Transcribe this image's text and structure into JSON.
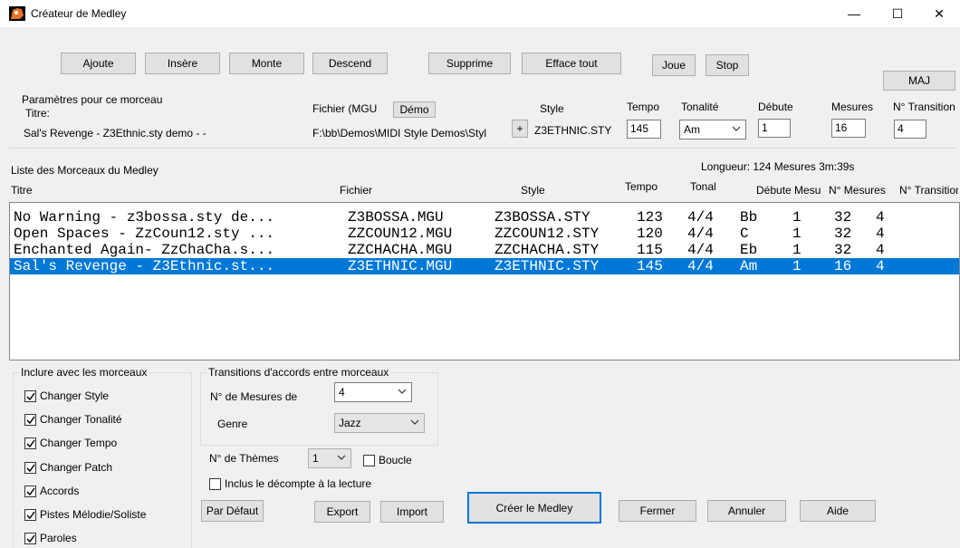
{
  "window": {
    "title": "Créateur de Medley",
    "controls": {
      "minimize": "—",
      "maximize": "☐",
      "close": "✕"
    }
  },
  "toolbar": {
    "add": "Ajoute",
    "insert": "Insère",
    "up": "Monte",
    "down": "Descend",
    "delete": "Supprime",
    "clear_all": "Efface tout",
    "play": "Joue",
    "stop": "Stop",
    "update": "MAJ"
  },
  "params": {
    "group_label": "Paramètres pour ce morceau",
    "title_label": "Titre:",
    "title_value": "Sal's Revenge - Z3Ethnic.sty demo - -",
    "file_label": "Fichier (MGU",
    "demo_button": "Démo",
    "file_value": "F:\\bb\\Demos\\MIDI Style Demos\\Styl",
    "style_label": "Style",
    "style_plus": "+",
    "style_value": "Z3ETHNIC.STY",
    "tempo_label": "Tempo",
    "tempo_value": "145",
    "key_label": "Tonalité",
    "key_value": "Am",
    "start_label": "Débute",
    "start_value": "1",
    "measures_label": "Mesures",
    "measures_value": "16",
    "transition_label": "N° Transition",
    "transition_value": "4"
  },
  "list": {
    "label": "Liste des Morceaux du Medley",
    "length_text": "Longueur:  124 Mesures  3m:39s",
    "headers": {
      "title": "Titre",
      "file": "Fichier",
      "style": "Style",
      "tempo": "Tempo",
      "tonal": "Tonal",
      "start": "Débute Mesu",
      "measures": "N° Mesures",
      "transition": "N° Transition"
    },
    "rows": [
      {
        "title": "No Warning - z3bossa.sty de...",
        "file": "Z3BOSSA.MGU",
        "style": "Z3BOSSA.STY",
        "tempo": "123",
        "meter": "4/4",
        "key": "Bb",
        "start": "1",
        "measures": "32",
        "transition": "4",
        "selected": false
      },
      {
        "title": "Open Spaces - ZzCoun12.sty ...",
        "file": "ZZCOUN12.MGU",
        "style": "ZZCOUN12.STY",
        "tempo": "120",
        "meter": "4/4",
        "key": "C",
        "start": "1",
        "measures": "32",
        "transition": "4",
        "selected": false
      },
      {
        "title": "Enchanted Again- ZzChaCha.s...",
        "file": "ZZCHACHA.MGU",
        "style": "ZZCHACHA.STY",
        "tempo": "115",
        "meter": "4/4",
        "key": "Eb",
        "start": "1",
        "measures": "32",
        "transition": "4",
        "selected": false
      },
      {
        "title": "Sal's Revenge - Z3Ethnic.st...",
        "file": "Z3ETHNIC.MGU",
        "style": "Z3ETHNIC.STY",
        "tempo": "145",
        "meter": "4/4",
        "key": "Am",
        "start": "1",
        "measures": "16",
        "transition": "4",
        "selected": true
      }
    ]
  },
  "include": {
    "group_label": "Inclure avec les morceaux",
    "items": [
      {
        "label": "Changer Style",
        "checked": true
      },
      {
        "label": "Changer Tonalité",
        "checked": true
      },
      {
        "label": "Changer Tempo",
        "checked": true
      },
      {
        "label": "Changer Patch",
        "checked": true
      },
      {
        "label": "Accords",
        "checked": true
      },
      {
        "label": "Pistes Mélodie/Soliste",
        "checked": true
      },
      {
        "label": "Paroles",
        "checked": true
      }
    ]
  },
  "transitions": {
    "group_label": "Transitions d'accords entre morceaux",
    "measures_label": "N° de Mesures de",
    "measures_value": "4",
    "genre_label": "Genre",
    "genre_value": "Jazz",
    "themes_label": "N° de Thèmes",
    "themes_value": "1",
    "loop_label": "Boucle",
    "loop_checked": false,
    "countin_label": "Inclus le décompte à la lecture",
    "countin_checked": false
  },
  "bottom": {
    "default": "Par Défaut",
    "export": "Export",
    "import": "Import",
    "create": "Créer le Medley",
    "close": "Fermer",
    "cancel": "Annuler",
    "help": "Aide"
  },
  "colors": {
    "accent": "#0078d7",
    "window_bg": "#f0f0f0",
    "button_bg": "#e1e1e1"
  }
}
